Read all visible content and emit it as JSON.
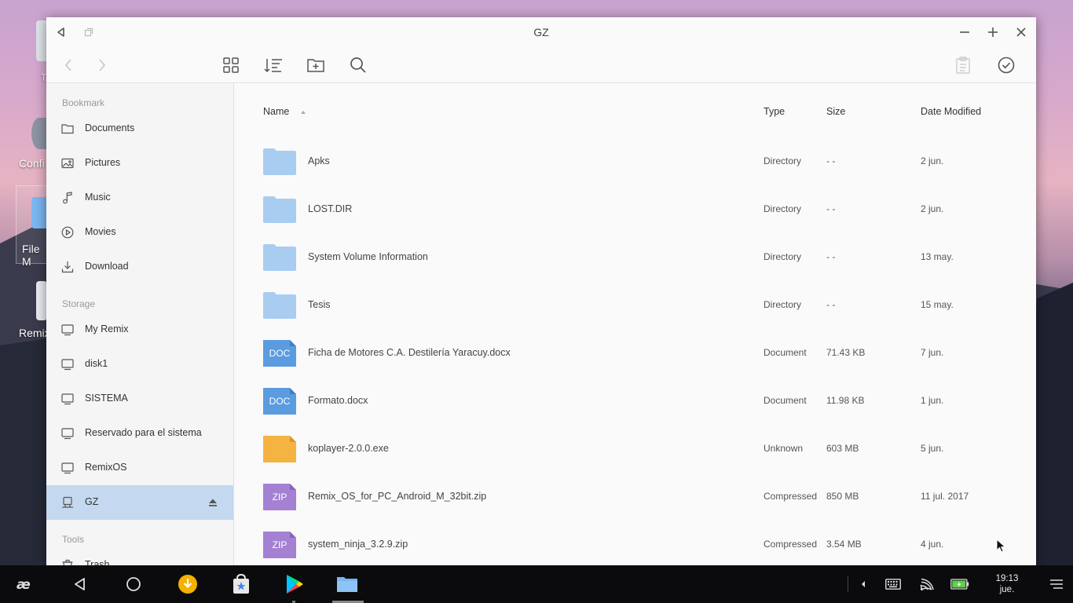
{
  "window": {
    "title": "GZ"
  },
  "desktop": {
    "icons": [
      {
        "label": "T",
        "name": "trash-desktop-icon"
      },
      {
        "label": "Confi",
        "name": "settings-desktop-icon"
      },
      {
        "label": "File M",
        "name": "file-manager-desktop-icon"
      },
      {
        "label": "Remix",
        "name": "remix-desktop-icon"
      }
    ]
  },
  "sidebar": {
    "bookmark_header": "Bookmark",
    "bookmarks": [
      {
        "label": "Documents",
        "icon": "folder-icon"
      },
      {
        "label": "Pictures",
        "icon": "image-icon"
      },
      {
        "label": "Music",
        "icon": "music-icon"
      },
      {
        "label": "Movies",
        "icon": "play-circle-icon"
      },
      {
        "label": "Download",
        "icon": "download-icon"
      }
    ],
    "storage_header": "Storage",
    "storage": [
      {
        "label": "My Remix",
        "icon": "monitor-icon"
      },
      {
        "label": "disk1",
        "icon": "monitor-icon"
      },
      {
        "label": "SISTEMA",
        "icon": "monitor-icon"
      },
      {
        "label": "Reservado para el sistema",
        "icon": "monitor-icon"
      },
      {
        "label": "RemixOS",
        "icon": "monitor-icon"
      },
      {
        "label": "GZ",
        "icon": "usb-drive-icon",
        "selected": true
      }
    ],
    "tools_header": "Tools",
    "tools": [
      {
        "label": "Trash",
        "icon": "trash-icon"
      }
    ]
  },
  "columns": {
    "name": "Name",
    "type": "Type",
    "size": "Size",
    "date": "Date Modified"
  },
  "files": [
    {
      "name": "Apks",
      "type": "Directory",
      "size": "- -",
      "date": "2 jun.",
      "kind": "folder"
    },
    {
      "name": "LOST.DIR",
      "type": "Directory",
      "size": "- -",
      "date": "2 jun.",
      "kind": "folder"
    },
    {
      "name": "System Volume Information",
      "type": "Directory",
      "size": "- -",
      "date": "13 may.",
      "kind": "folder"
    },
    {
      "name": "Tesis",
      "type": "Directory",
      "size": "- -",
      "date": "15 may.",
      "kind": "folder"
    },
    {
      "name": "Ficha de Motores C.A. Destilería Yaracuy.docx",
      "type": "Document",
      "size": "71.43 KB",
      "date": "7 jun.",
      "kind": "doc",
      "badge": "DOC"
    },
    {
      "name": "Formato.docx",
      "type": "Document",
      "size": "11.98 KB",
      "date": "1 jun.",
      "kind": "doc",
      "badge": "DOC"
    },
    {
      "name": "koplayer-2.0.0.exe",
      "type": "Unknown",
      "size": "603 MB",
      "date": "5 jun.",
      "kind": "unknown"
    },
    {
      "name": "Remix_OS_for_PC_Android_M_32bit.zip",
      "type": "Compressed",
      "size": "850 MB",
      "date": "11 jul. 2017",
      "kind": "zip",
      "badge": "ZIP"
    },
    {
      "name": "system_ninja_3.2.9.zip",
      "type": "Compressed",
      "size": "3.54 MB",
      "date": "4 jun.",
      "kind": "zip",
      "badge": "ZIP"
    }
  ],
  "colors": {
    "folder": "#a9cdf1",
    "doc": "#5b9be0",
    "zip": "#a481d3",
    "unknown": "#f5b342",
    "selected": "#c4d8ef"
  },
  "taskbar": {
    "clock_time": "19:13",
    "clock_day": "jue."
  }
}
